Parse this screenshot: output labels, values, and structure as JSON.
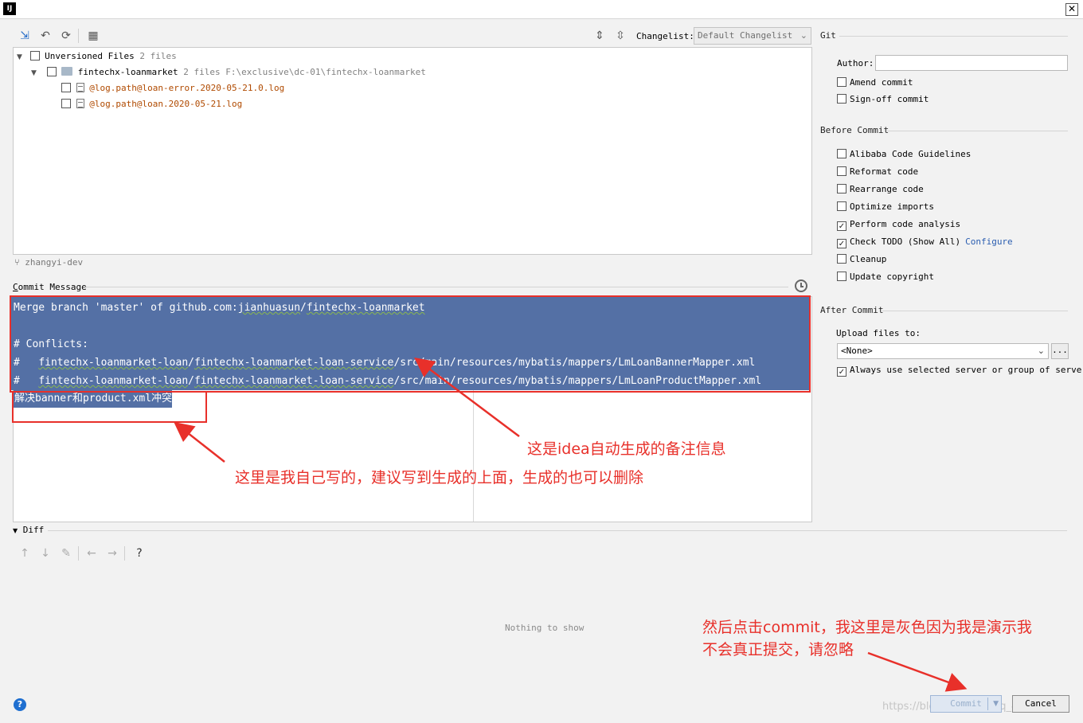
{
  "window": {
    "app_icon_text": "IJ",
    "close_glyph": "✕"
  },
  "toolbar": {
    "changelist_label": "Changelist:",
    "changelist_value": "Default Changelist"
  },
  "tree": {
    "root": {
      "label": "Unversioned Files",
      "count": "2 files"
    },
    "module": {
      "label": "fintechx-loanmarket",
      "count": "2 files",
      "path": "F:\\exclusive\\dc-01\\fintechx-loanmarket"
    },
    "files": [
      "@log.path@loan-error.2020-05-21.0.log",
      "@log.path@loan.2020-05-21.log"
    ]
  },
  "branch": {
    "name": "zhangyi-dev"
  },
  "commit_message": {
    "label": "Commit Message",
    "lines": [
      {
        "prefix": "Merge branch 'master' of github.com:",
        "u1": "jianhuasun",
        "sep": "/",
        "u2": "fintechx-loanmarket",
        "rest": ""
      },
      {
        "text": ""
      },
      {
        "text": "# Conflicts:"
      },
      {
        "prefix": "#   ",
        "u1": "fintechx-loanmarket-loan",
        "sep": "/",
        "u2": "fintechx-loanmarket-loan-service",
        "rest": "/src/main/resources/mybatis/mappers/LmLoanBannerMapper.xml"
      },
      {
        "prefix": "#   ",
        "u1": "fintechx-loanmarket-loan",
        "sep": "/",
        "u2": "fintechx-loanmarket-loan-service",
        "rest": "/src/main/resources/mybatis/mappers/LmLoanProductMapper.xml"
      }
    ],
    "user_line": "解决banner和product.xml冲突"
  },
  "annotations": {
    "auto": "这是idea自动生成的备注信息",
    "mine": "这里是我自己写的，建议写到生成的上面，生成的也可以删除",
    "commit_line1": "然后点击commit，我这里是灰色因为我是演示我",
    "commit_line2": "不会真正提交，请忽略"
  },
  "diff": {
    "label": "Diff",
    "empty_text": "Nothing to show",
    "help_glyph": "?"
  },
  "git": {
    "title": "Git",
    "author_label": "Author:",
    "amend": "Amend commit",
    "signoff": "Sign-off commit"
  },
  "before_commit": {
    "title": "Before Commit",
    "options": [
      {
        "label": "Alibaba Code Guidelines",
        "checked": false
      },
      {
        "label": "Reformat code",
        "checked": false
      },
      {
        "label": "Rearrange code",
        "checked": false
      },
      {
        "label": "Optimize imports",
        "checked": false
      },
      {
        "label": "Perform code analysis",
        "checked": true
      },
      {
        "label": "Check TODO (Show All)",
        "checked": true,
        "link": "Configure"
      },
      {
        "label": "Cleanup",
        "checked": false
      },
      {
        "label": "Update copyright",
        "checked": false
      }
    ]
  },
  "after_commit": {
    "title": "After Commit",
    "upload_label": "Upload files to:",
    "server_value": "<None>",
    "browse": "...",
    "always_use": "Always use selected server or group of servers"
  },
  "buttons": {
    "commit": "Commit",
    "cancel": "Cancel",
    "help": "?"
  },
  "watermark": "https://blog.csdn.net/qq_42164105",
  "colors": {
    "selection": "#5470a5",
    "annotation_red": "#e8302a",
    "link": "#2a5db0"
  },
  "icons": [
    "move-to-changelist-icon",
    "revert-icon",
    "refresh-icon",
    "group-by-icon",
    "expand-all-icon",
    "collapse-all-icon",
    "history-icon",
    "branch-icon"
  ]
}
